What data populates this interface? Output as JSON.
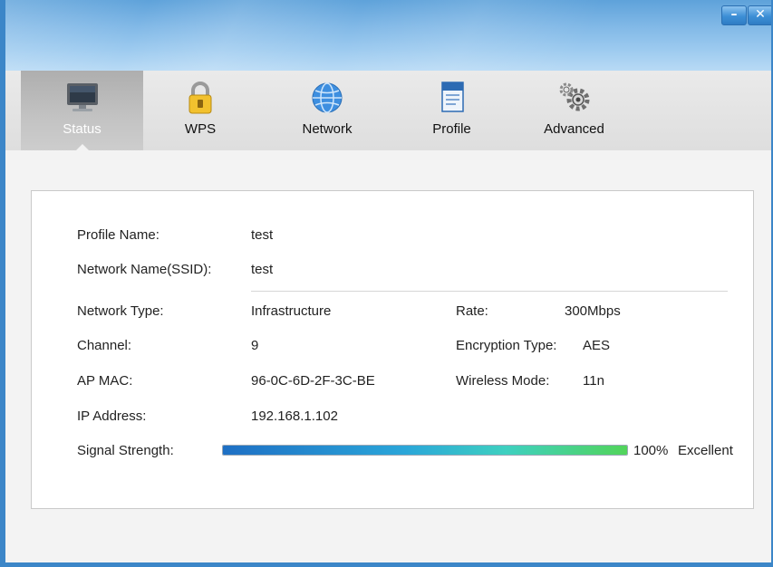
{
  "window": {
    "minimize_glyph": "–",
    "close_glyph": "✕"
  },
  "tabs": [
    {
      "label": "Status",
      "icon": "monitor-icon",
      "active": true
    },
    {
      "label": "WPS",
      "icon": "padlock-icon",
      "active": false
    },
    {
      "label": "Network",
      "icon": "globe-icon",
      "active": false
    },
    {
      "label": "Profile",
      "icon": "profile-document-icon",
      "active": false
    },
    {
      "label": "Advanced",
      "icon": "gears-icon",
      "active": false
    }
  ],
  "status": {
    "profile_name_label": "Profile Name:",
    "profile_name": "test",
    "ssid_label": "Network Name(SSID):",
    "ssid": "test",
    "network_type_label": "Network Type:",
    "network_type": "Infrastructure",
    "rate_label": "Rate:",
    "rate": "300Mbps",
    "channel_label": "Channel:",
    "channel": "9",
    "encryption_label": "Encryption Type:",
    "encryption": "AES",
    "ap_mac_label": "AP MAC:",
    "ap_mac": "96-0C-6D-2F-3C-BE",
    "wireless_mode_label": "Wireless Mode:",
    "wireless_mode": "11n",
    "ip_label": "IP Address:",
    "ip": "192.168.1.102",
    "signal_label": "Signal Strength:",
    "signal_percent": 100,
    "signal_text": "100%",
    "signal_quality": "Excellent"
  },
  "colors": {
    "window_border": "#3c86c8",
    "active_tab": "#b8b8b8"
  }
}
